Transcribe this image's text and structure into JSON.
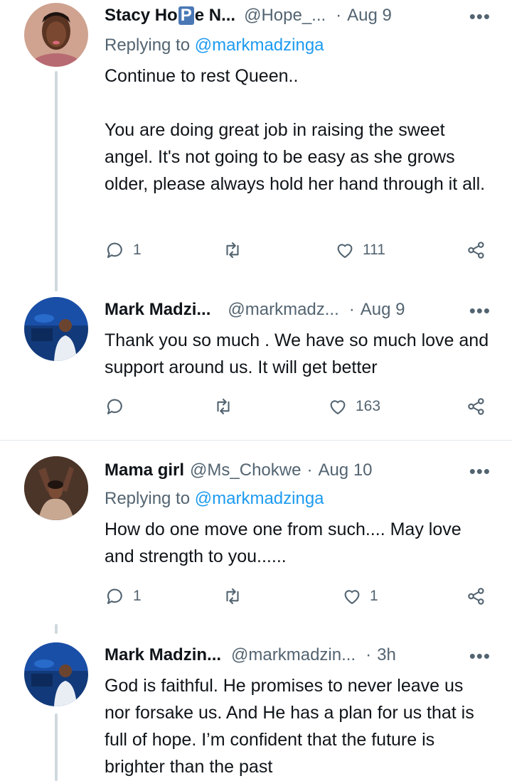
{
  "tweets": [
    {
      "name_a": "Stacy Ho",
      "name_badge": "P",
      "name_b": "e N...",
      "handle": "@Hope_...",
      "date": "Aug 9",
      "replying_prefix": "Replying to",
      "replying_handle": "@markmadzinga",
      "text": "Continue to rest Queen..\n\nYou are doing great job in raising the sweet angel. It's not going to be easy as she grows older, please always hold her hand through it all.",
      "replies": "1",
      "retweets": "",
      "likes": "111"
    },
    {
      "name": "Mark Madzi...",
      "handle": "@markmadz...",
      "date": "Aug 9",
      "text": "Thank you so much . We have so much love and support around us. It will get better",
      "replies": "",
      "retweets": "",
      "likes": "163"
    },
    {
      "name": "Mama girl",
      "handle": "@Ms_Chokwe",
      "date": "Aug 10",
      "replying_prefix": "Replying to",
      "replying_handle": "@markmadzinga",
      "text": "How do one move one from such.... May love and strength to you......",
      "replies": "1",
      "retweets": "",
      "likes": "1"
    },
    {
      "name": "Mark Madzin...",
      "handle": "@markmadzin...",
      "date": "3h",
      "text": "God is faithful. He promises to never leave us nor forsake us. And He has a plan for us that is full of hope. I’m confident that the future is brighter than the past"
    }
  ],
  "icons": {
    "reply": "reply-icon",
    "retweet": "retweet-icon",
    "like": "heart-icon",
    "share": "share-icon",
    "more": "more-icon"
  },
  "colors": {
    "link": "#1d9bf0",
    "secondary_text": "#536471",
    "thread_line": "#cfd9de"
  }
}
